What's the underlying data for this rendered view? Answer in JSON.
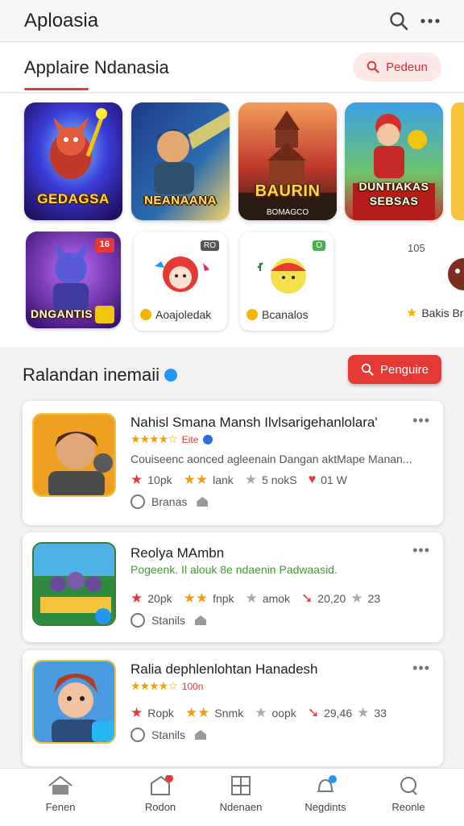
{
  "app": {
    "title": "Aploasia"
  },
  "header": {
    "tab_label": "Applaire Ndanasia",
    "pill_label": "Pedeun"
  },
  "games": {
    "featured": [
      {
        "title": "GEDAGSA",
        "subtitle": ""
      },
      {
        "title": "NEANAANA",
        "subtitle": ""
      },
      {
        "title": "BAURIN",
        "subtitle": "BOMAGCO"
      },
      {
        "title": "DUNTIAKAS",
        "subtitle": "SEBSAS"
      }
    ],
    "secondary": [
      {
        "title": "DNGANTIS",
        "badge": "16"
      },
      {
        "name": "Aoajoledak",
        "badge": "RO"
      },
      {
        "name": "Bcanalos",
        "badge": "O"
      },
      {
        "name": "Bakis Br",
        "badge": "105"
      }
    ]
  },
  "section": {
    "title": "Ralandan inemaii",
    "button_label": "Penguire"
  },
  "cards": [
    {
      "title": "Nahisl Smana Mansh Ilvlsarigehanlolara'",
      "rating_stars": "★★★★☆",
      "rating_tag": "Eite",
      "description": "Couiseenc aonced agleenain Dangan aktMape Manan...",
      "stats": [
        "10pk",
        "lank",
        "5 nokS",
        "01 W"
      ],
      "footer": "Branas"
    },
    {
      "title": "Reolya MAmbn",
      "rating_stars": "",
      "rating_tag": "",
      "description": "Pogeenk. Il alouk 8e ndaenin Padwaasid.",
      "stats": [
        "20pk",
        "fnpk",
        "amok",
        "20,20",
        "23"
      ],
      "footer": "Stanils"
    },
    {
      "title": "Ralia dephlenlohtan Hanadesh",
      "rating_stars": "★★★★☆",
      "rating_tag": "100n",
      "description": "",
      "stats": [
        "Ropk",
        "Snmk",
        "oopk",
        "29,46",
        "33"
      ],
      "footer": "Stanils"
    }
  ],
  "bottom_nav": [
    {
      "label": "Fenen",
      "icon": "home-icon"
    },
    {
      "label": "Rodon",
      "icon": "tag-icon"
    },
    {
      "label": "Ndenaen",
      "icon": "grid-icon"
    },
    {
      "label": "Negdints",
      "icon": "bell-icon"
    },
    {
      "label": "Reonle",
      "icon": "chat-icon"
    }
  ],
  "colors": {
    "accent": "#e53935",
    "pill_bg": "#fde8e8",
    "star": "#f4a000",
    "verified": "#2196f3"
  }
}
